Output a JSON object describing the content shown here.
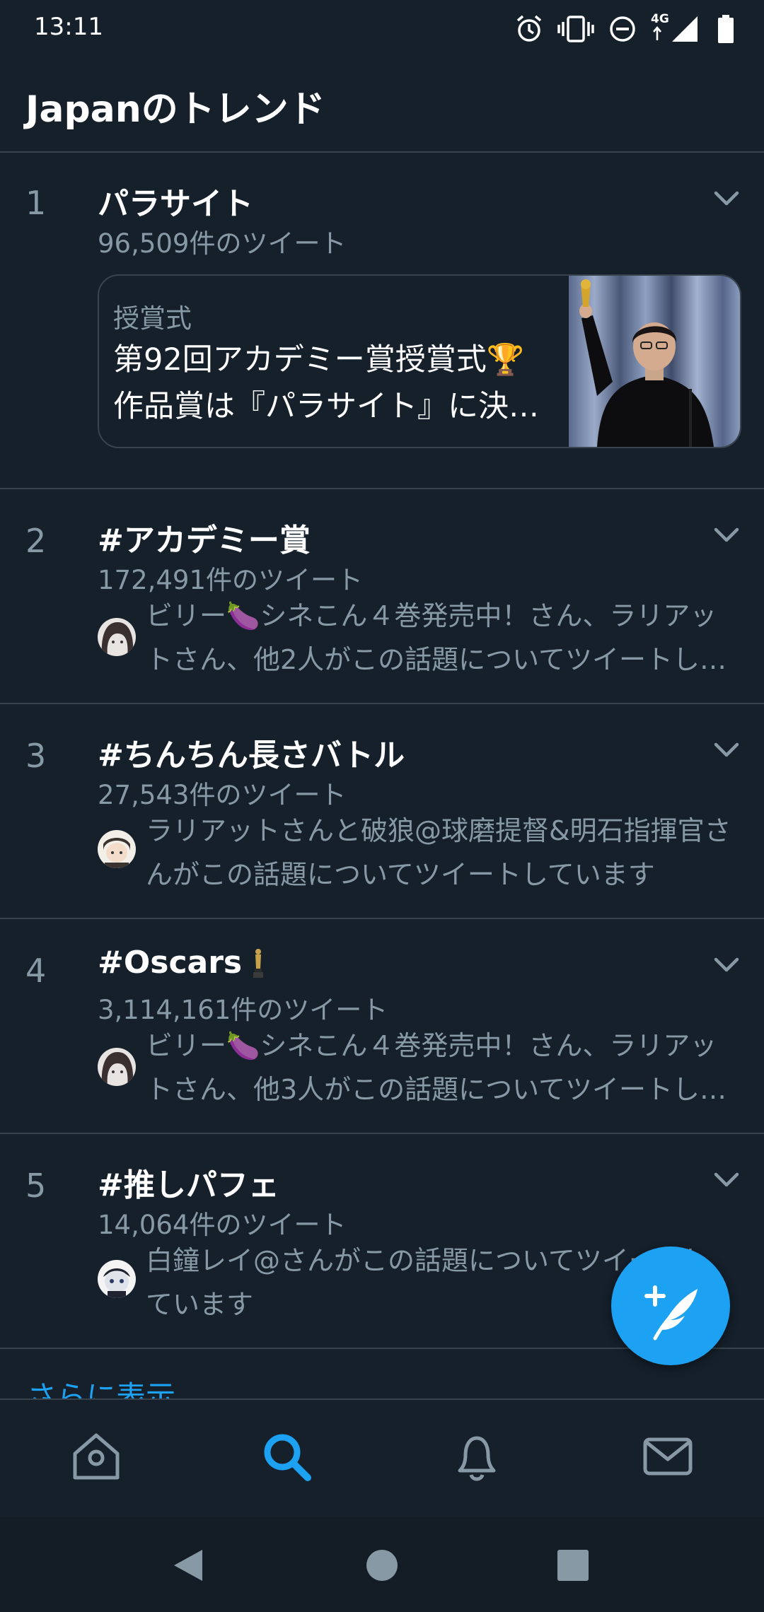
{
  "status_bar": {
    "time": "13:11",
    "network": "4G",
    "icons": [
      "alarm-icon",
      "vibrate-icon",
      "do-not-disturb-icon",
      "signal-icon",
      "battery-icon"
    ]
  },
  "header": {
    "title": "Japanのトレンド"
  },
  "trends": [
    {
      "rank": "1",
      "name": "パラサイト",
      "count": "96,509件のツイート",
      "news": {
        "category": "授賞式",
        "line1": "第92回アカデミー賞授賞式🏆",
        "line2": "作品賞は『パラサイト』に決…"
      }
    },
    {
      "rank": "2",
      "name": "#アカデミー賞",
      "count": "172,491件のツイート",
      "desc_line1": "ビリー🍆シネこん４巻発売中！さん、ラリアッ",
      "desc_line2": "トさん、他2人がこの話題についてツイートし…"
    },
    {
      "rank": "3",
      "name": "#ちんちん長さバトル",
      "count": "27,543件のツイート",
      "desc_line1": "ラリアットさんと破狼@球磨提督&明石指揮官さ",
      "desc_line2": "んがこの話題についてツイートしています"
    },
    {
      "rank": "4",
      "name": "#Oscars",
      "count": "3,114,161件のツイート",
      "desc_line1": "ビリー🍆シネこん４巻発売中！さん、ラリアッ",
      "desc_line2": "トさん、他3人がこの話題についてツイートし…"
    },
    {
      "rank": "5",
      "name": "#推しパフェ",
      "count": "14,064件のツイート",
      "desc_line1": "白鐘レイ@さんがこの話題についてツイートし",
      "desc_line2": "ています"
    }
  ],
  "more_link": "さらに表示",
  "tabs": [
    "home-icon",
    "search-icon",
    "notifications-icon",
    "messages-icon"
  ],
  "colors": {
    "background": "#15202b",
    "accent": "#1da1f2",
    "secondary_text": "#8899a6",
    "divider": "#38444d"
  }
}
